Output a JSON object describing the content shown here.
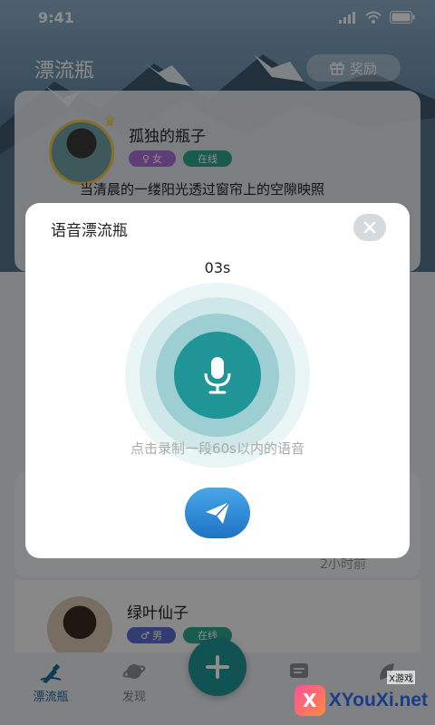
{
  "status_bar": {
    "time": "9:41"
  },
  "header": {
    "title": "漂流瓶",
    "reward_label": "奖励"
  },
  "list": {
    "items": [
      {
        "name": "孤独的瓶子",
        "gender": "女",
        "status": "在线",
        "message": "当清晨的一缕阳光透过窗帘上的空隙映照"
      },
      {
        "time_ago": "2小时前"
      },
      {
        "name": "绿叶仙子",
        "gender": "男",
        "status": "在线"
      }
    ]
  },
  "modal": {
    "title": "语音漂流瓶",
    "timer": "03s",
    "hint": "点击录制一段60s以内的语音"
  },
  "tabbar": {
    "tabs": [
      {
        "label": "漂流瓶"
      },
      {
        "label": "发现"
      }
    ]
  },
  "watermark": {
    "site": "XYouXi.net",
    "sub": "X游戏",
    "logo": "X"
  },
  "colors": {
    "accent": "#1f9598",
    "send": "#2a88d8",
    "online": "#2fa88f",
    "female": "#b06fd8",
    "male": "#5a6fcf"
  }
}
